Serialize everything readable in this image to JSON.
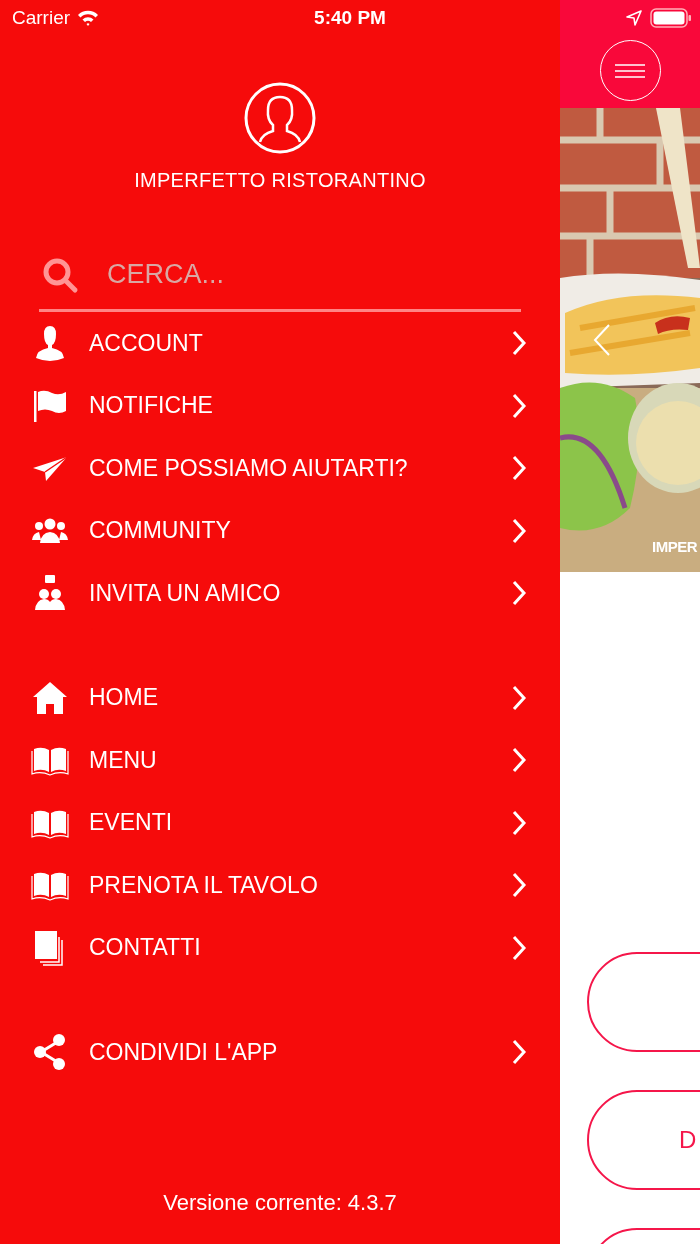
{
  "status_bar": {
    "carrier": "Carrier",
    "time": "5:40 PM"
  },
  "profile": {
    "name": "IMPERFETTO RISTORANTINO"
  },
  "search": {
    "placeholder": "CERCA..."
  },
  "menu_groups": [
    [
      {
        "kind": "person",
        "label": "ACCOUNT"
      },
      {
        "kind": "flag",
        "label": "NOTIFICHE"
      },
      {
        "kind": "plane",
        "label": "COME POSSIAMO AIUTARTI?"
      },
      {
        "kind": "group",
        "label": "COMMUNITY"
      },
      {
        "kind": "invite",
        "label": "INVITA UN AMICO"
      }
    ],
    [
      {
        "kind": "home",
        "label": "HOME"
      },
      {
        "kind": "book",
        "label": "MENU"
      },
      {
        "kind": "book",
        "label": "EVENTI"
      },
      {
        "kind": "book",
        "label": "PRENOTA IL TAVOLO"
      },
      {
        "kind": "pages",
        "label": "CONTATTI"
      }
    ],
    [
      {
        "kind": "share",
        "label": "CONDIVIDI L'APP"
      }
    ]
  ],
  "version": "Versione corrente: 4.3.7",
  "main": {
    "slide_caption": "IMPER",
    "buttons": [
      {
        "kind": "pill"
      },
      {
        "kind": "pill",
        "label": "D"
      },
      {
        "kind": "pill"
      }
    ]
  }
}
